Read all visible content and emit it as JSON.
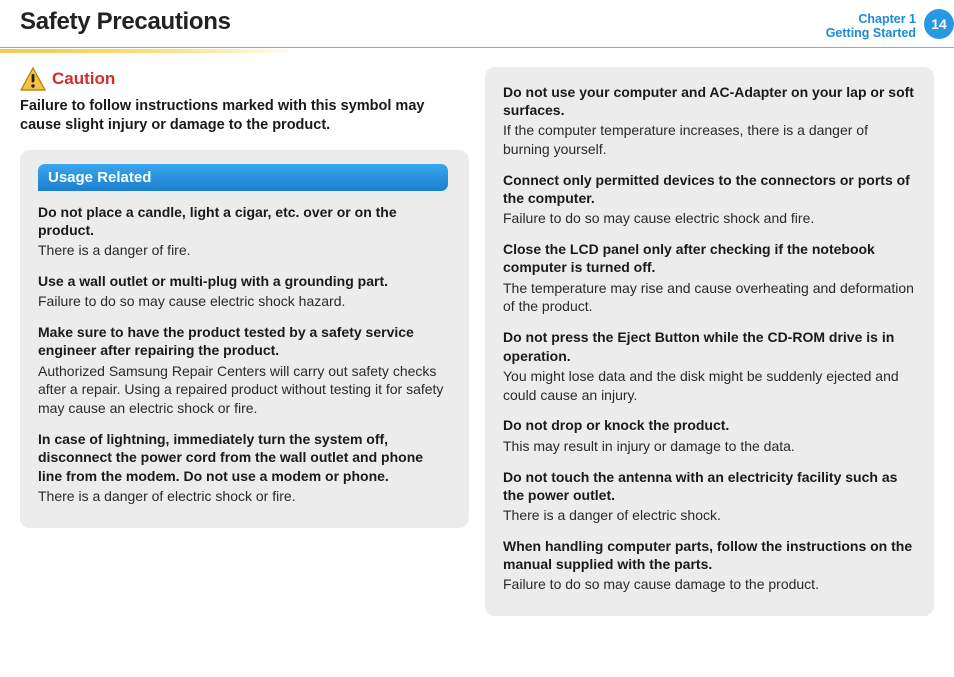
{
  "header": {
    "title": "Safety Precautions",
    "chapter_line1": "Chapter 1",
    "chapter_line2": "Getting Started",
    "page_number": "14"
  },
  "caution": {
    "label": "Caution",
    "text": "Failure to follow instructions marked with this symbol may cause slight injury or damage to the product."
  },
  "left_section": {
    "pill": "Usage Related",
    "items": [
      {
        "h": "Do not place a candle, light a cigar, etc. over or on the product.",
        "b": "There is a danger of fire."
      },
      {
        "h": "Use a wall outlet or multi-plug with a grounding part.",
        "b": "Failure to do so may cause electric shock hazard."
      },
      {
        "h": "Make sure to have the product tested by a safety service engineer after repairing the product.",
        "b": "Authorized Samsung Repair Centers will carry out safety checks after a repair. Using a repaired product without testing it for safety may cause an electric shock or fire."
      },
      {
        "h": "In case of lightning, immediately turn the system off, disconnect the power cord from the wall outlet and phone line from the modem. Do not use a modem or phone.",
        "b": "There is a danger of electric shock or fire."
      }
    ]
  },
  "right_section": {
    "items": [
      {
        "h": "Do not use your computer and AC-Adapter on your lap or soft surfaces.",
        "b": "If the computer temperature increases, there is a danger of burning yourself."
      },
      {
        "h": "Connect only permitted devices to the connectors or ports of the computer.",
        "b": "Failure to do so may cause electric shock and fire."
      },
      {
        "h": "Close the LCD panel only after checking if the notebook computer is turned off.",
        "b": "The temperature may rise and cause overheating and deformation of the product."
      },
      {
        "h": "Do not press the Eject Button while the CD-ROM drive is in operation.",
        "b": "You might lose data and the disk might be suddenly ejected and could cause an injury."
      },
      {
        "h": "Do not drop or knock the product.",
        "b": "This may result in injury or damage to the data."
      },
      {
        "h": "Do not touch the antenna with an electricity facility such as the power outlet.",
        "b": "There is a danger of electric shock."
      },
      {
        "h": "When handling computer parts, follow the instructions on the manual supplied with the parts.",
        "b": "Failure to do so may cause damage to the product."
      }
    ]
  }
}
